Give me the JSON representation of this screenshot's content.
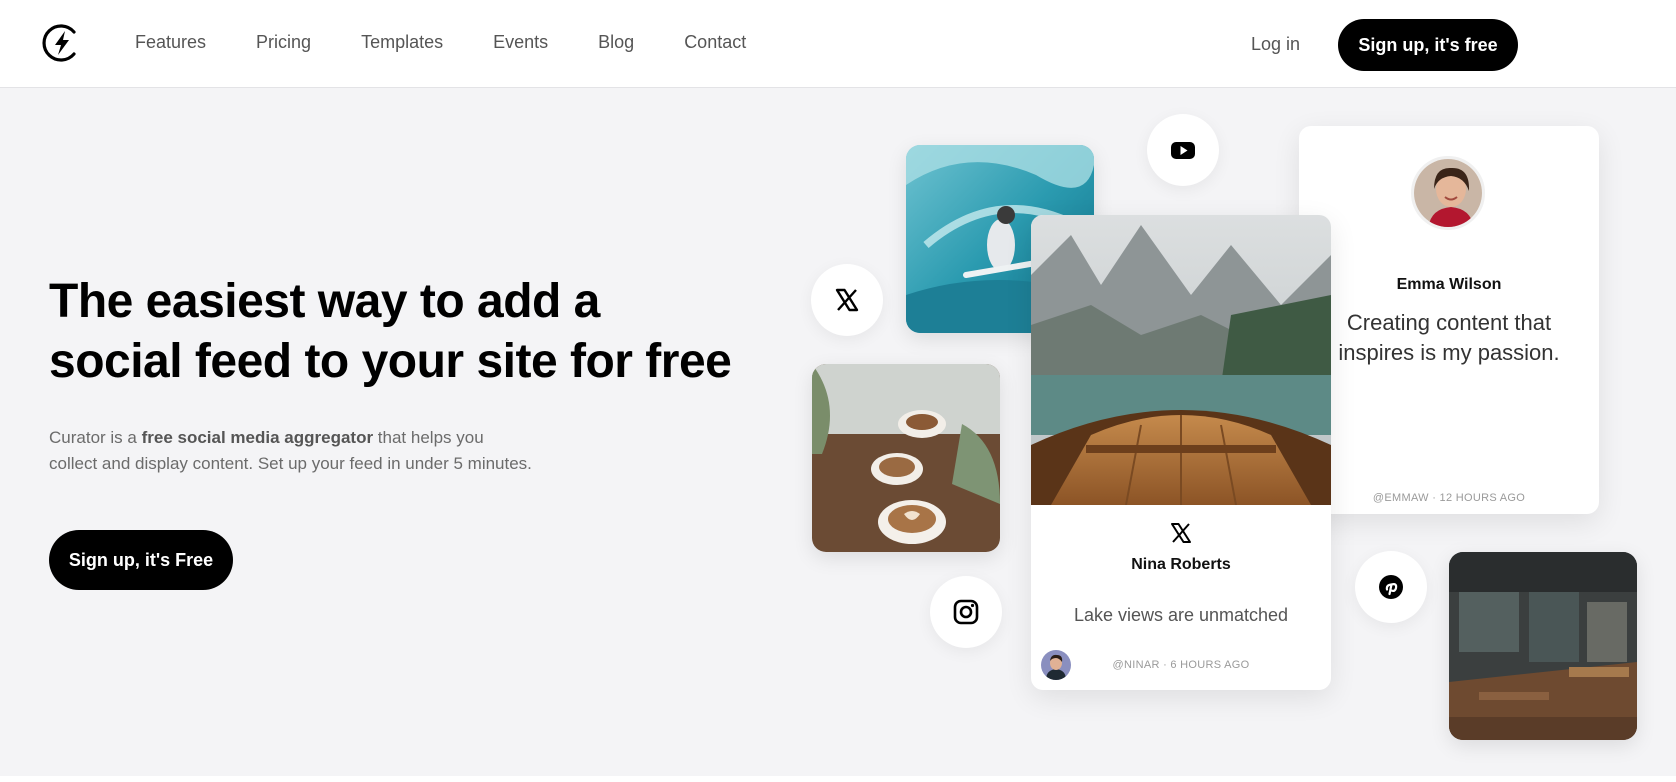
{
  "nav": {
    "logo_icon": "lightning-bolt-icon",
    "links": [
      "Features",
      "Pricing",
      "Templates",
      "Events",
      "Blog",
      "Contact"
    ],
    "login_label": "Log in",
    "signup_label": "Sign up, it's free"
  },
  "hero": {
    "title_line1": "The easiest way to add a",
    "title_line2": "social feed to your site for free",
    "desc_prefix": "Curator is a ",
    "desc_bold": "free social media aggregator",
    "desc_suffix": " that helps you",
    "desc_line2": "collect and display content. Set up your feed in under 5 minutes.",
    "cta_label": "Sign up, it's Free"
  },
  "social_icons": [
    "x-icon",
    "youtube-icon",
    "instagram-icon",
    "pinterest-icon"
  ],
  "cards": {
    "emma": {
      "name": "Emma Wilson",
      "text": "Creating content that inspires is my passion.",
      "meta": "@EMMAW · 12 HOURS AGO"
    },
    "nina": {
      "name": "Nina Roberts",
      "text": "Lake views are unmatched",
      "meta": "@NINAR · 6 HOURS AGO"
    }
  },
  "colors": {
    "background": "#f4f4f6",
    "primary_button": "#000000",
    "nav_text": "#555555"
  }
}
